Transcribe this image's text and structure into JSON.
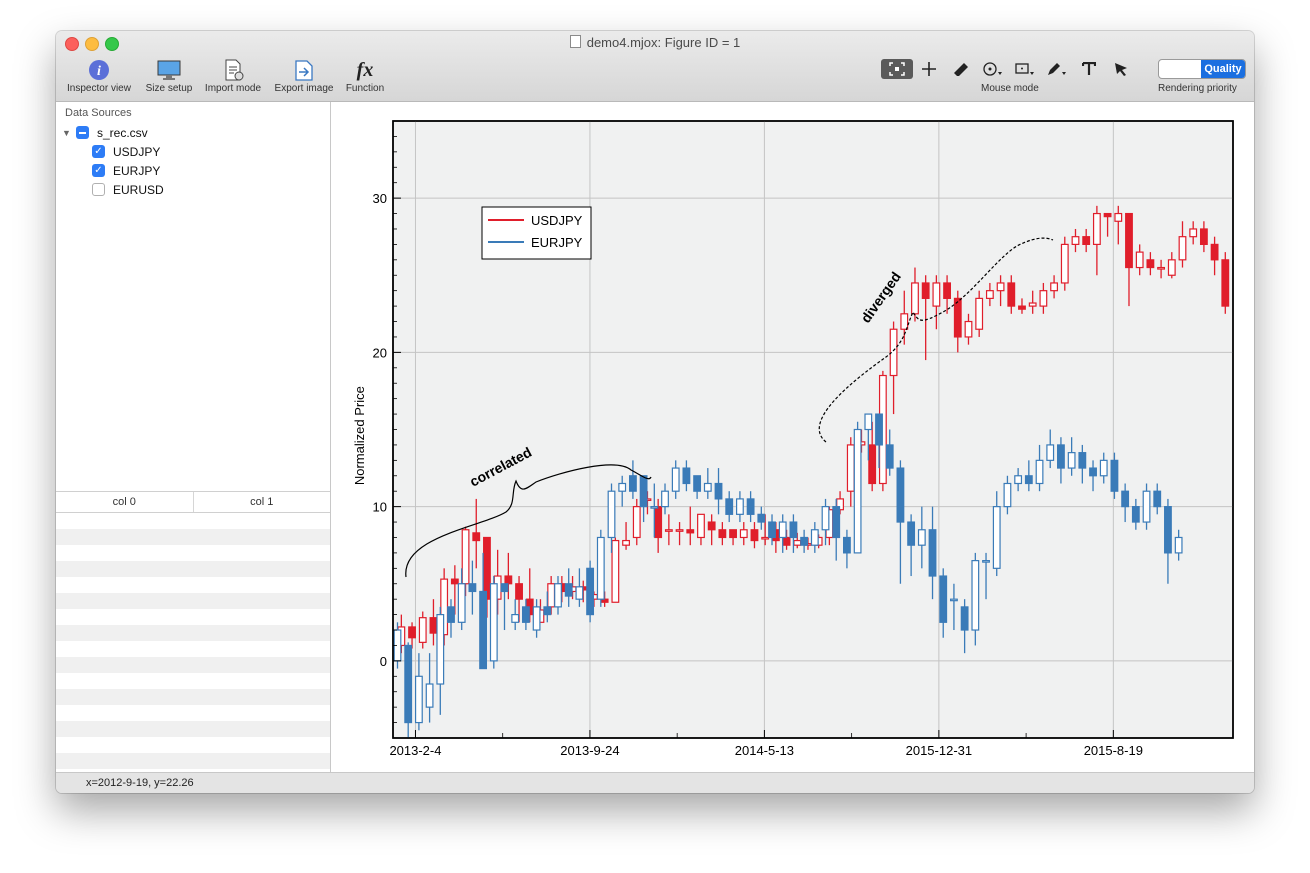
{
  "window": {
    "title": "demo4.mjox: Figure ID = 1"
  },
  "toolbar": {
    "buttons": [
      {
        "label": "Inspector view",
        "icon": "info-icon"
      },
      {
        "label": "Size setup",
        "icon": "monitor-icon"
      },
      {
        "label": "Import mode",
        "icon": "import-doc-icon"
      },
      {
        "label": "Export image",
        "icon": "export-icon"
      },
      {
        "label": "Function",
        "icon": "function-icon",
        "glyph": "fx"
      }
    ],
    "mouse_mode_label": "Mouse mode",
    "rendering_priority_label": "Rendering priority",
    "quality_label": "Quality"
  },
  "sidebar": {
    "title": "Data Sources",
    "file": "s_rec.csv",
    "series": [
      {
        "label": "USDJPY",
        "checked": true
      },
      {
        "label": "EURJPY",
        "checked": true
      },
      {
        "label": "EURUSD",
        "checked": false
      }
    ],
    "table_columns": [
      "col 0",
      "col 1"
    ]
  },
  "status": {
    "text": "x=2012-9-19, y=22.26"
  },
  "chart_data": {
    "type": "candlestick",
    "ylabel": "Normalized Price",
    "xlabel": "",
    "ylim": [
      -5,
      35
    ],
    "yticks": [
      0,
      10,
      20,
      30
    ],
    "xtick_labels": [
      "2013-2-4",
      "2013-9-24",
      "2014-5-13",
      "2015-12-31",
      "2015-8-19"
    ],
    "grid": true,
    "legend_position": "top-left",
    "legend": [
      "USDJPY",
      "EURJPY"
    ],
    "colors": {
      "USDJPY": "#e01e2b",
      "EURJPY": "#3a7bb8"
    },
    "annotations": [
      "correlated",
      "diverged"
    ],
    "series": [
      {
        "name": "USDJPY",
        "values": [
          [
            1.0,
            2.2,
            0.5,
            3.0
          ],
          [
            2.2,
            1.5,
            0.8,
            2.5
          ],
          [
            1.2,
            2.8,
            0.8,
            3.2
          ],
          [
            2.8,
            1.8,
            1.0,
            4.0
          ],
          [
            1.7,
            5.3,
            1.0,
            6.0
          ],
          [
            5.3,
            5.0,
            3.0,
            6.2
          ],
          [
            5.0,
            8.5,
            4.2,
            8.7
          ],
          [
            8.3,
            7.8,
            6.0,
            10.5
          ],
          [
            8.0,
            4.0,
            2.8,
            8.0
          ],
          [
            4.0,
            5.5,
            3.0,
            7.2
          ],
          [
            5.5,
            5.0,
            4.0,
            7.0
          ],
          [
            5.0,
            4.0,
            2.5,
            5.5
          ],
          [
            4.0,
            3.0,
            2.5,
            6.0
          ],
          [
            2.5,
            3.3,
            2.5,
            4.0
          ],
          [
            3.5,
            5.0,
            3.0,
            5.5
          ],
          [
            5.0,
            4.5,
            3.8,
            5.5
          ],
          [
            4.5,
            4.8,
            4.0,
            5.5
          ],
          [
            4.8,
            4.6,
            3.8,
            5.2
          ],
          [
            4.0,
            4.3,
            3.5,
            4.5
          ],
          [
            4.0,
            3.8,
            3.5,
            4.5
          ],
          [
            3.8,
            7.8,
            3.8,
            8.0
          ],
          [
            7.5,
            7.8,
            7.2,
            9.0
          ],
          [
            8.0,
            10.0,
            7.5,
            10.5
          ],
          [
            10.5,
            10.5,
            9.5,
            11.0
          ],
          [
            10.0,
            8.0,
            7.0,
            10.5
          ],
          [
            8.5,
            8.5,
            7.5,
            9.5
          ],
          [
            8.5,
            8.5,
            7.5,
            9.0
          ],
          [
            8.5,
            8.3,
            7.5,
            10.0
          ],
          [
            8.0,
            9.5,
            7.5,
            9.5
          ],
          [
            9.0,
            8.5,
            7.5,
            9.5
          ],
          [
            8.5,
            8.0,
            7.5,
            9.0
          ],
          [
            8.5,
            8.0,
            7.5,
            8.5
          ],
          [
            8.0,
            8.5,
            7.5,
            9.0
          ],
          [
            8.5,
            7.8,
            7.3,
            9.0
          ],
          [
            8.0,
            8.0,
            7.5,
            9.5
          ],
          [
            8.5,
            7.8,
            7.0,
            9.0
          ],
          [
            8.0,
            7.5,
            7.2,
            8.5
          ],
          [
            7.5,
            7.8,
            7.3,
            8.3
          ],
          [
            7.5,
            7.6,
            7.2,
            8.0
          ],
          [
            7.5,
            8.0,
            7.3,
            8.2
          ],
          [
            8.0,
            9.8,
            7.5,
            10.0
          ],
          [
            9.8,
            10.5,
            9.5,
            11.0
          ],
          [
            11.0,
            14.0,
            10.0,
            14.5
          ],
          [
            14.0,
            14.2,
            13.5,
            15.0
          ],
          [
            14.0,
            11.5,
            11.0,
            15.5
          ],
          [
            11.5,
            18.5,
            11.0,
            18.8
          ],
          [
            18.5,
            21.5,
            16.0,
            22.0
          ],
          [
            21.5,
            22.5,
            20.5,
            24.0
          ],
          [
            22.5,
            24.5,
            22.0,
            25.5
          ],
          [
            24.5,
            23.5,
            19.5,
            25.0
          ],
          [
            23.0,
            24.5,
            21.5,
            25.0
          ],
          [
            24.5,
            23.5,
            22.5,
            25.0
          ],
          [
            23.5,
            21.0,
            20.0,
            24.0
          ],
          [
            21.0,
            22.0,
            20.5,
            22.5
          ],
          [
            21.5,
            23.5,
            21.0,
            24.0
          ],
          [
            23.5,
            24.0,
            23.0,
            24.5
          ],
          [
            24.0,
            24.5,
            23.0,
            25.0
          ],
          [
            24.5,
            23.0,
            22.5,
            25.0
          ],
          [
            23.0,
            22.8,
            22.5,
            23.5
          ],
          [
            23.0,
            23.2,
            22.5,
            24.0
          ],
          [
            23.0,
            24.0,
            22.5,
            24.5
          ],
          [
            24.0,
            24.5,
            23.5,
            25.0
          ],
          [
            24.5,
            27.0,
            24.0,
            27.5
          ],
          [
            27.0,
            27.5,
            26.5,
            28.0
          ],
          [
            27.5,
            27.0,
            26.5,
            28.0
          ],
          [
            27.0,
            29.0,
            25.0,
            29.5
          ],
          [
            29.0,
            28.8,
            27.5,
            29.0
          ],
          [
            28.5,
            29.0,
            27.0,
            29.5
          ],
          [
            29.0,
            25.5,
            23.0,
            29.0
          ],
          [
            25.5,
            26.5,
            25.0,
            27.0
          ],
          [
            26.0,
            25.5,
            25.0,
            26.5
          ],
          [
            25.5,
            25.5,
            24.8,
            26.0
          ],
          [
            25.0,
            26.0,
            24.8,
            26.5
          ],
          [
            26.0,
            27.5,
            25.5,
            28.5
          ],
          [
            27.5,
            28.0,
            27.0,
            28.5
          ],
          [
            28.0,
            27.0,
            26.5,
            28.5
          ],
          [
            27.0,
            26.0,
            25.0,
            27.5
          ],
          [
            26.0,
            23.0,
            22.5,
            26.5
          ]
        ]
      },
      {
        "name": "EURJPY",
        "values": [
          [
            0.0,
            2.0,
            -0.5,
            2.5
          ],
          [
            1.0,
            -4.0,
            -5.0,
            1.2
          ],
          [
            -4.0,
            -1.0,
            -4.5,
            0.5
          ],
          [
            -3.0,
            -1.5,
            -4.0,
            0.5
          ],
          [
            -1.5,
            3.0,
            -3.5,
            3.5
          ],
          [
            3.5,
            2.5,
            1.5,
            4.0
          ],
          [
            2.5,
            5.0,
            2.0,
            6.0
          ],
          [
            5.0,
            4.5,
            3.0,
            6.5
          ],
          [
            4.5,
            -0.5,
            -0.5,
            7.0
          ],
          [
            0.0,
            5.0,
            -0.5,
            5.5
          ],
          [
            5.0,
            4.5,
            2.0,
            5.0
          ],
          [
            2.5,
            3.0,
            2.0,
            4.0
          ],
          [
            3.5,
            2.5,
            2.0,
            4.0
          ],
          [
            2.0,
            3.5,
            1.5,
            4.0
          ],
          [
            3.5,
            3.0,
            2.5,
            4.5
          ],
          [
            3.5,
            5.0,
            3.0,
            5.5
          ],
          [
            5.0,
            4.2,
            3.5,
            6.0
          ],
          [
            4.0,
            4.8,
            3.5,
            6.0
          ],
          [
            6.0,
            3.0,
            2.5,
            6.5
          ],
          [
            4.0,
            8.0,
            3.5,
            8.5
          ],
          [
            8.0,
            11.0,
            7.0,
            11.5
          ],
          [
            11.0,
            11.5,
            10.0,
            12.0
          ],
          [
            12.0,
            11.0,
            10.5,
            13.0
          ],
          [
            12.0,
            10.0,
            9.0,
            12.0
          ],
          [
            10.0,
            10.0,
            8.0,
            11.5
          ],
          [
            10.0,
            11.0,
            9.5,
            11.5
          ],
          [
            11.0,
            12.5,
            10.5,
            13.0
          ],
          [
            12.5,
            11.5,
            11.0,
            13.0
          ],
          [
            12.0,
            11.0,
            10.5,
            12.0
          ],
          [
            11.0,
            11.5,
            10.5,
            12.5
          ],
          [
            11.5,
            10.5,
            9.5,
            12.5
          ],
          [
            10.5,
            9.5,
            9.0,
            11.0
          ],
          [
            9.5,
            10.5,
            9.0,
            11.0
          ],
          [
            10.5,
            9.5,
            9.0,
            11.0
          ],
          [
            9.5,
            9.0,
            8.5,
            10.0
          ],
          [
            9.0,
            8.0,
            7.5,
            9.5
          ],
          [
            8.0,
            9.0,
            7.0,
            9.5
          ],
          [
            9.0,
            8.0,
            7.0,
            9.5
          ],
          [
            8.0,
            7.5,
            7.0,
            8.5
          ],
          [
            7.5,
            8.5,
            7.0,
            9.0
          ],
          [
            8.5,
            10.0,
            7.5,
            10.5
          ],
          [
            10.0,
            8.0,
            6.5,
            10.5
          ],
          [
            8.0,
            7.0,
            6.0,
            8.5
          ],
          [
            7.0,
            15.0,
            7.0,
            15.5
          ],
          [
            15.0,
            16.0,
            13.0,
            16.0
          ],
          [
            16.0,
            14.0,
            12.5,
            16.0
          ],
          [
            14.0,
            12.5,
            12.0,
            15.0
          ],
          [
            12.5,
            9.0,
            5.0,
            13.0
          ],
          [
            9.0,
            7.5,
            5.5,
            9.5
          ],
          [
            7.5,
            8.5,
            6.0,
            10.0
          ],
          [
            8.5,
            5.5,
            4.0,
            10.0
          ],
          [
            5.5,
            2.5,
            1.5,
            6.0
          ],
          [
            4.0,
            4.0,
            2.0,
            5.0
          ],
          [
            3.5,
            2.0,
            0.5,
            4.0
          ],
          [
            2.0,
            6.5,
            1.0,
            7.0
          ],
          [
            6.5,
            6.5,
            4.0,
            7.0
          ],
          [
            6.0,
            10.0,
            5.5,
            11.0
          ],
          [
            10.0,
            11.5,
            9.5,
            12.0
          ],
          [
            11.5,
            12.0,
            11.0,
            12.5
          ],
          [
            12.0,
            11.5,
            11.0,
            13.0
          ],
          [
            11.5,
            13.0,
            11.0,
            14.0
          ],
          [
            13.0,
            14.0,
            12.5,
            15.0
          ],
          [
            14.0,
            12.5,
            11.5,
            14.5
          ],
          [
            12.5,
            13.5,
            12.0,
            14.5
          ],
          [
            13.5,
            12.5,
            11.5,
            14.0
          ],
          [
            12.5,
            12.0,
            11.0,
            13.0
          ],
          [
            12.0,
            13.0,
            11.5,
            13.5
          ],
          [
            13.0,
            11.0,
            10.5,
            13.5
          ],
          [
            11.0,
            10.0,
            9.0,
            11.5
          ],
          [
            10.0,
            9.0,
            8.5,
            10.5
          ],
          [
            9.0,
            11.0,
            8.5,
            11.5
          ],
          [
            11.0,
            10.0,
            9.5,
            11.5
          ],
          [
            10.0,
            7.0,
            5.0,
            10.5
          ],
          [
            7.0,
            8.0,
            6.5,
            8.5
          ]
        ]
      }
    ]
  }
}
